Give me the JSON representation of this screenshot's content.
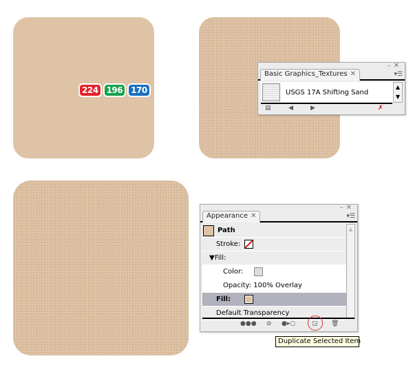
{
  "canvas": {
    "base_color": "#dfc3a6"
  },
  "color_badges": [
    {
      "value": "224",
      "color": "#e8202a"
    },
    {
      "value": "196",
      "color": "#1aa150"
    },
    {
      "value": "170",
      "color": "#1b6fc0"
    }
  ],
  "textures_panel": {
    "tab": "Basic Graphics_Textures",
    "item": "USGS 17A Shifting Sand"
  },
  "appearance_panel": {
    "tab": "Appearance",
    "path": "Path",
    "stroke": "Stroke:",
    "fill_group": "Fill:",
    "color": "Color:",
    "opacity": "Opacity: 100% Overlay",
    "fill": "Fill:",
    "default_transparency": "Default Transparency"
  },
  "tooltip": "Duplicate Selected Item"
}
